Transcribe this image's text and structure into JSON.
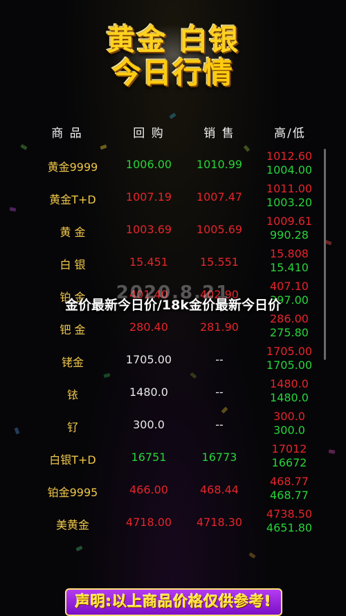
{
  "title": {
    "line1": "黄金 白银",
    "line2": "今日行情"
  },
  "header": {
    "name": "商 品",
    "buy": "回 购",
    "sell": "销 售",
    "hilo": "高/低"
  },
  "rows": [
    {
      "name": "黄金9999",
      "buy": "1006.00",
      "sell": "1010.99",
      "high": "1012.60",
      "low": "1004.00"
    },
    {
      "name": "黄金T+D",
      "buy": "1007.19",
      "sell": "1007.47",
      "high": "1011.00",
      "low": "1003.20"
    },
    {
      "name": "黄 金",
      "buy": "1003.69",
      "sell": "1005.69",
      "high": "1009.61",
      "low": "990.28"
    },
    {
      "name": "白 银",
      "buy": "15.451",
      "sell": "15.551",
      "high": "15.808",
      "low": "15.410"
    },
    {
      "name": "铂 金",
      "buy": "401.40",
      "sell": "402.90",
      "high": "407.10",
      "low": "397.00"
    },
    {
      "name": "钯 金",
      "buy": "280.40",
      "sell": "281.90",
      "high": "286.00",
      "low": "275.80"
    },
    {
      "name": "铑金",
      "buy": "1705.00",
      "sell": "--",
      "high": "1705.00",
      "low": "1705.00"
    },
    {
      "name": "铱",
      "buy": "1480.0",
      "sell": "--",
      "high": "1480.0",
      "low": "1480.0"
    },
    {
      "name": "钌",
      "buy": "300.0",
      "sell": "--",
      "high": "300.0",
      "low": "300.0"
    },
    {
      "name": "白银T+D",
      "buy": "16751",
      "sell": "16773",
      "high": "17012",
      "low": "16672"
    },
    {
      "name": "铂金9995",
      "buy": "466.00",
      "sell": "468.44",
      "high": "468.77",
      "low": "468.77"
    },
    {
      "name": "美黄金",
      "buy": "4718.00",
      "sell": "4718.30",
      "high": "4738.50",
      "low": "4651.80"
    }
  ],
  "watermark": "2020.8.21",
  "overlay_title": "金价最新今日价/18k金价最新今日价",
  "notice": "声明:以上商品价格仅供参考!",
  "colors": {
    "up": "#e5252a",
    "down": "#27d43a",
    "gold": "#f0c74a",
    "neutral": "#e8e8e8"
  }
}
